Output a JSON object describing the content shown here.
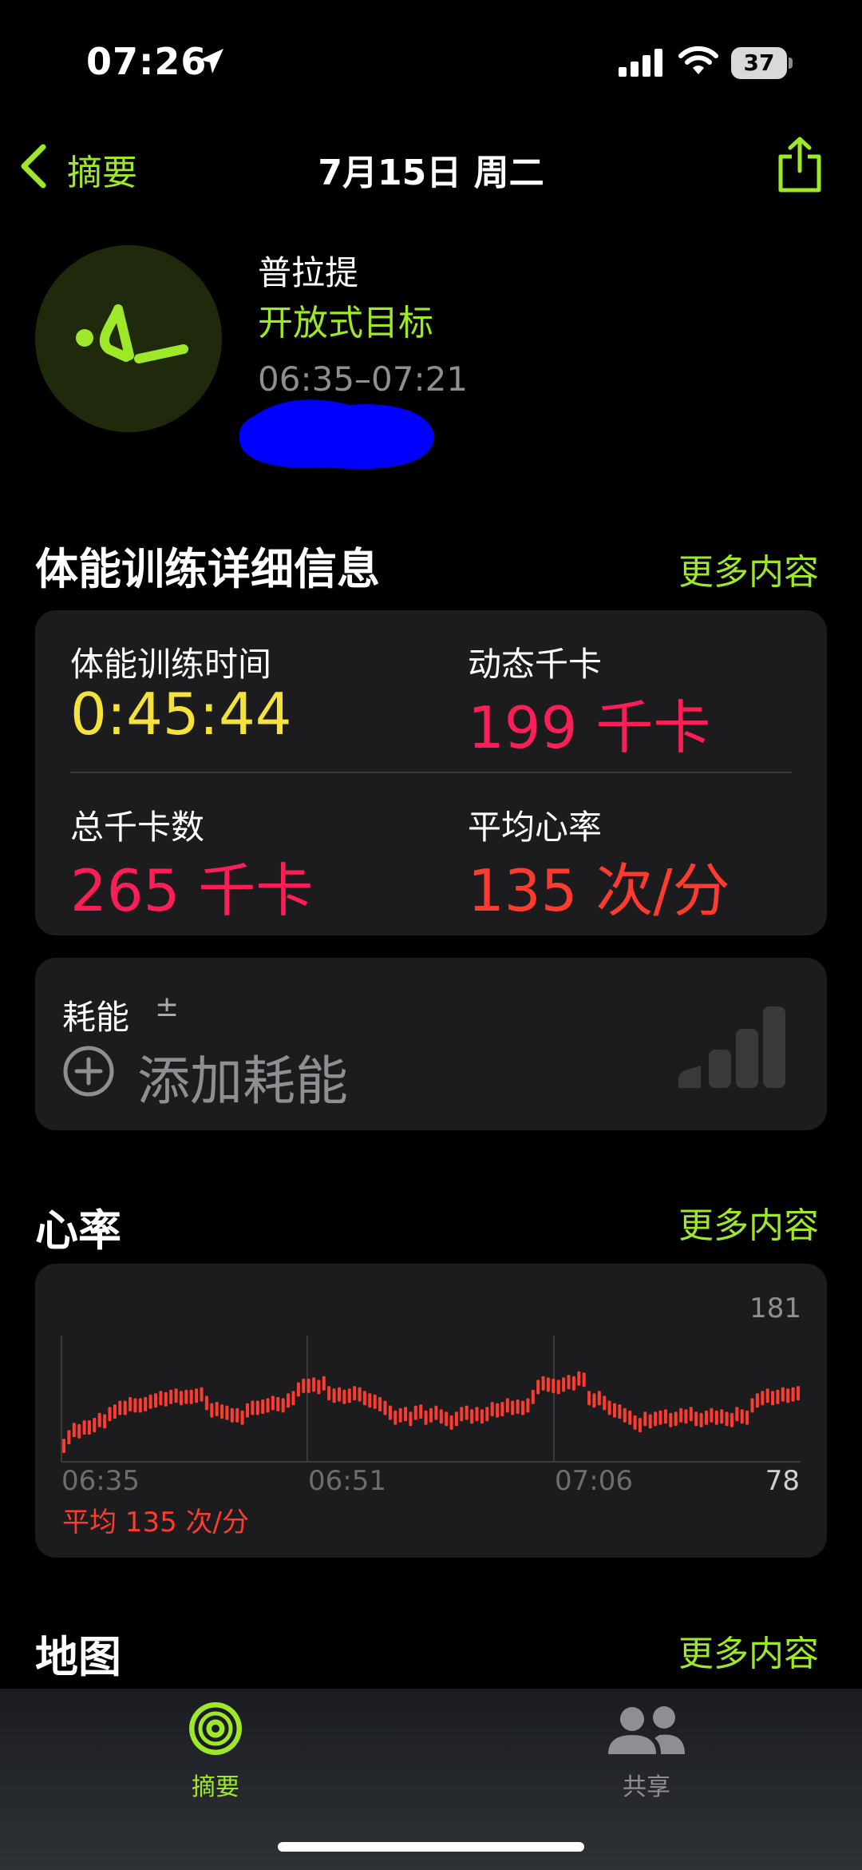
{
  "status_bar": {
    "time": "07:26",
    "battery": "37"
  },
  "nav": {
    "back_label": "摘要",
    "title": "7月15日 周二"
  },
  "workout": {
    "name": "普拉提",
    "goal": "开放式目标",
    "time_range": "06:35–07:21"
  },
  "details": {
    "title": "体能训练详细信息",
    "more": "更多内容",
    "metrics": [
      {
        "label": "体能训练时间",
        "value": "0:45:44"
      },
      {
        "label": "动态千卡",
        "value": "199 千卡"
      },
      {
        "label": "总千卡数",
        "value": "265 千卡"
      },
      {
        "label": "平均心率",
        "value": "135 次/分"
      }
    ]
  },
  "effort": {
    "label": "耗能",
    "pm": "±",
    "add_label": "添加耗能"
  },
  "heart_rate": {
    "title": "心率",
    "more": "更多内容",
    "max_label": "181",
    "min_label": "78",
    "ticks": [
      "06:35",
      "06:51",
      "07:06"
    ],
    "average": "平均 135 次/分"
  },
  "map": {
    "title": "地图",
    "more": "更多内容"
  },
  "tabbar": {
    "tabs": [
      {
        "label": "摘要",
        "active": true
      },
      {
        "label": "共享",
        "active": false
      }
    ]
  },
  "colors": {
    "accent": "#9ee829",
    "duration": "#f5e33b",
    "calories": "#fc1e56",
    "heart": "#fe3b2f",
    "redaction": "#0000ff"
  },
  "chart_data": {
    "type": "line",
    "x_start": "06:35",
    "x_end": "07:21",
    "ylim": [
      78,
      181
    ],
    "values": [
      91,
      98,
      104,
      103,
      106,
      106,
      108,
      112,
      111,
      117,
      119,
      122,
      122,
      125,
      124,
      124,
      125,
      127,
      128,
      130,
      129,
      131,
      132,
      130,
      131,
      131,
      132,
      133,
      126,
      120,
      121,
      119,
      118,
      116,
      116,
      114,
      120,
      122,
      122,
      123,
      124,
      126,
      125,
      124,
      128,
      130,
      137,
      140,
      140,
      141,
      139,
      142,
      134,
      132,
      133,
      131,
      132,
      134,
      133,
      130,
      128,
      127,
      125,
      122,
      118,
      114,
      116,
      117,
      113,
      118,
      119,
      114,
      116,
      118,
      115,
      113,
      110,
      113,
      117,
      118,
      115,
      117,
      115,
      117,
      121,
      120,
      121,
      124,
      122,
      123,
      122,
      124,
      131,
      139,
      142,
      141,
      140,
      139,
      141,
      143,
      142,
      146,
      145,
      130,
      128,
      130,
      126,
      122,
      120,
      119,
      116,
      114,
      110,
      108,
      113,
      111,
      113,
      114,
      115,
      112,
      113,
      116,
      115,
      117,
      113,
      112,
      114,
      116,
      114,
      115,
      113,
      112,
      117,
      115,
      114,
      124,
      128,
      130,
      132,
      130,
      131,
      133,
      132,
      133,
      134
    ]
  }
}
